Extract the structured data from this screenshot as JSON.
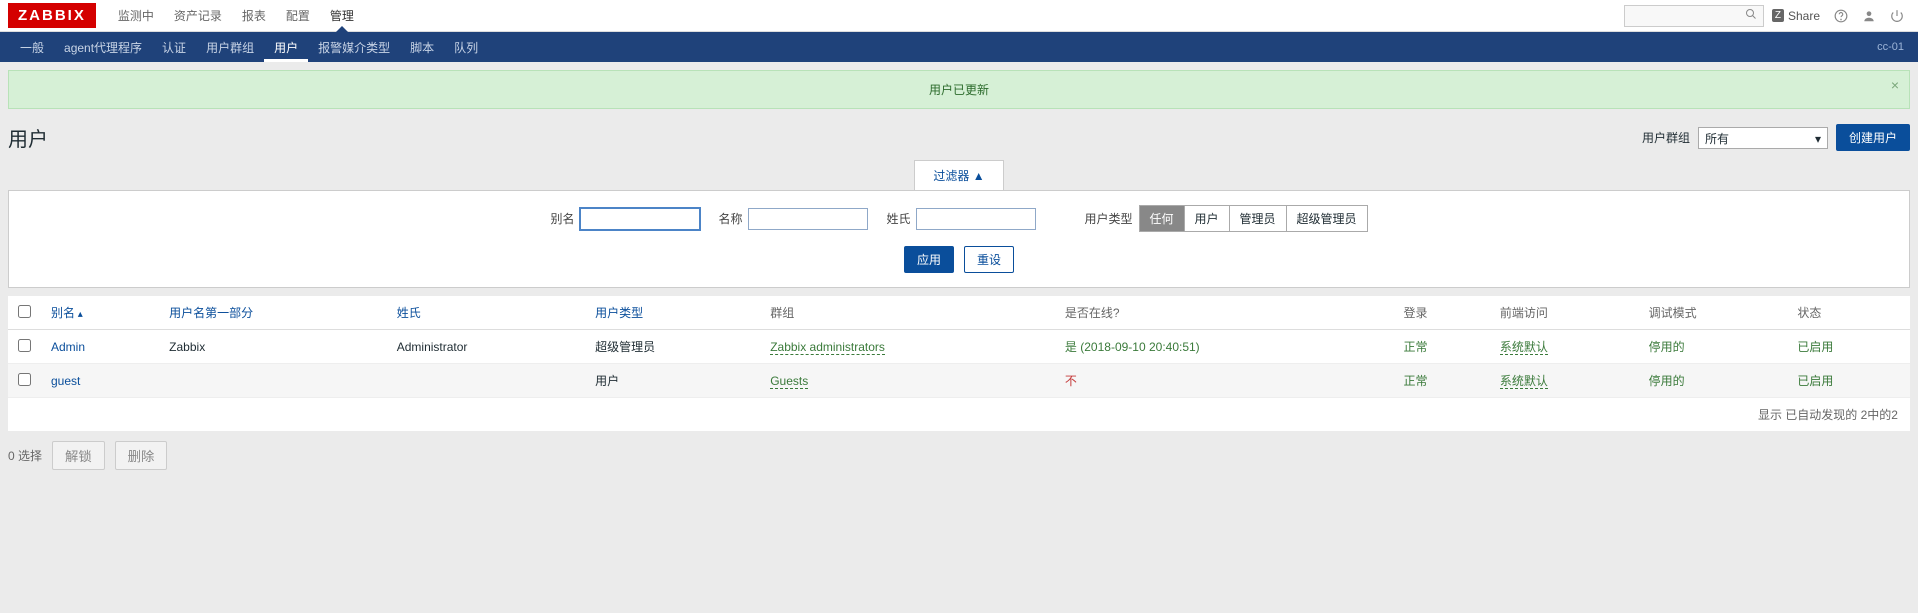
{
  "brand": "ZABBIX",
  "top_menu": [
    "监测中",
    "资产记录",
    "报表",
    "配置",
    "管理"
  ],
  "top_menu_active": 4,
  "share": "Share",
  "sub_menu": [
    "一般",
    "agent代理程序",
    "认证",
    "用户群组",
    "用户",
    "报警媒介类型",
    "脚本",
    "队列"
  ],
  "sub_menu_active": 4,
  "server_name": "cc-01",
  "banner_msg": "用户已更新",
  "page_title": "用户",
  "group_label": "用户群组",
  "group_selected": "所有",
  "create_btn": "创建用户",
  "filter_tab": "过滤器 ▲",
  "filter": {
    "alias_label": "别名",
    "name_label": "名称",
    "surname_label": "姓氏",
    "usertype_label": "用户类型",
    "seg": [
      "任何",
      "用户",
      "管理员",
      "超级管理员"
    ],
    "apply": "应用",
    "reset": "重设"
  },
  "columns": {
    "alias": "别名",
    "firstname": "用户名第一部分",
    "surname": "姓氏",
    "usertype": "用户类型",
    "groups": "群组",
    "online": "是否在线?",
    "login": "登录",
    "frontend": "前端访问",
    "debug": "调试模式",
    "status": "状态"
  },
  "rows": [
    {
      "alias": "Admin",
      "firstname": "Zabbix",
      "surname": "Administrator",
      "usertype": "超级管理员",
      "groups": "Zabbix administrators",
      "online": "是 (2018-09-10 20:40:51)",
      "online_class": "green",
      "login": "正常",
      "frontend": "系统默认",
      "debug": "停用的",
      "status": "已启用"
    },
    {
      "alias": "guest",
      "firstname": "",
      "surname": "",
      "usertype": "用户",
      "groups": "Guests",
      "online": "不",
      "online_class": "red",
      "login": "正常",
      "frontend": "系统默认",
      "debug": "停用的",
      "status": "已启用"
    }
  ],
  "table_footer": "显示 已自动发现的 2中的2",
  "selected_label": "0 选择",
  "bulk_unlock": "解锁",
  "bulk_delete": "删除"
}
